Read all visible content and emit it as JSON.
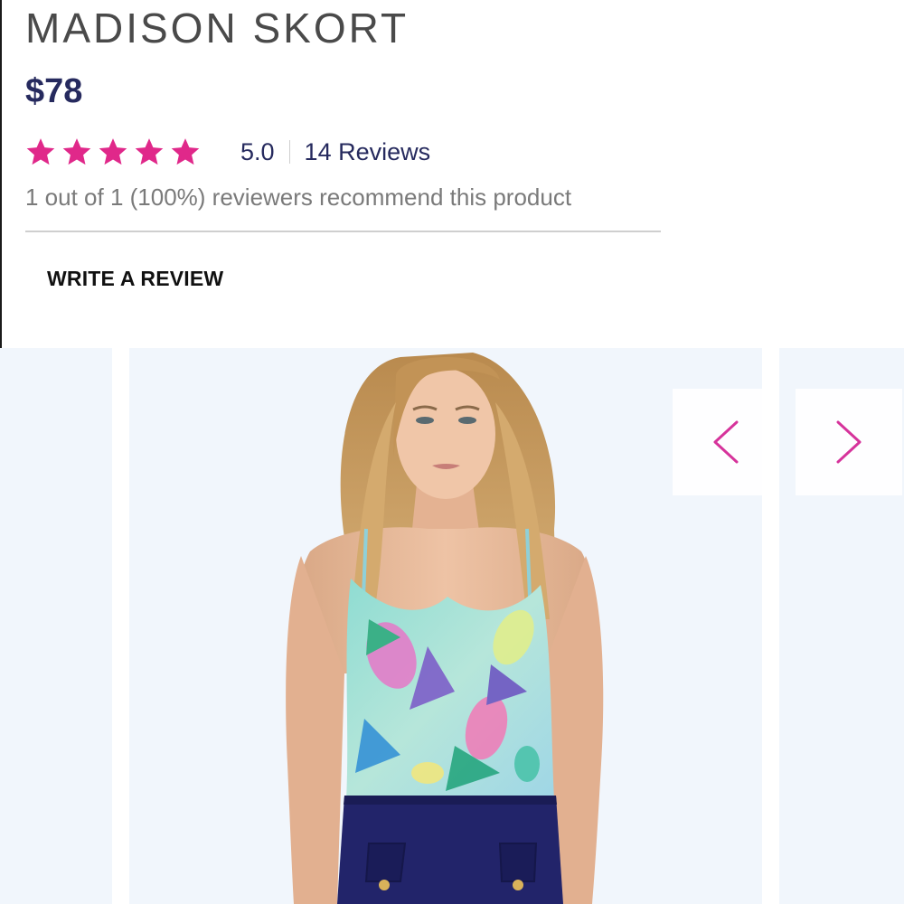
{
  "product": {
    "title": "MADISON SKORT",
    "price": "$78"
  },
  "rating": {
    "stars": 5,
    "max_stars": 5,
    "value": "5.0",
    "reviews_label": "14 Reviews",
    "recommend_text": "1 out of 1 (100%) reviewers recommend this product"
  },
  "actions": {
    "write_review": "WRITE A REVIEW"
  },
  "carousel": {
    "prev_icon": "chevron-left-icon",
    "next_icon": "chevron-right-icon"
  },
  "colors": {
    "accent_pink": "#e0288a",
    "navy": "#262a5e",
    "slide_background": "#f1f6fc"
  }
}
